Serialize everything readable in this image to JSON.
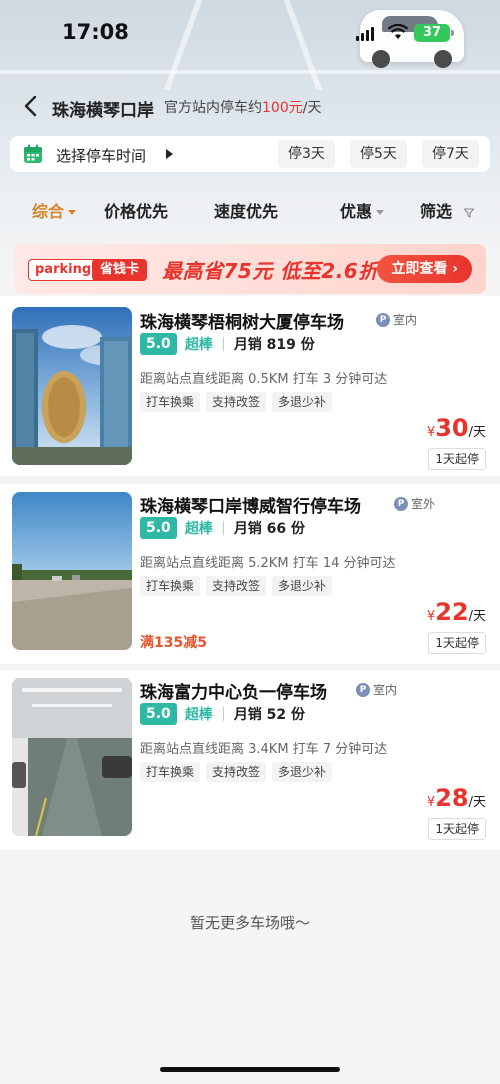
{
  "status_bar": {
    "time": "17:08",
    "battery": "37"
  },
  "header": {
    "title": "珠海横琴口岸",
    "subtitle_prefix": "官方站内停车约",
    "subtitle_price": "100元",
    "subtitle_suffix": "/天"
  },
  "time_bar": {
    "label": "选择停车时间",
    "chips": [
      "停3天",
      "停5天",
      "停7天"
    ]
  },
  "sort_tabs": [
    {
      "label": "综合",
      "active": true
    },
    {
      "label": "价格优先",
      "active": false
    },
    {
      "label": "速度优先",
      "active": false
    },
    {
      "label": "优惠",
      "active": false
    },
    {
      "label": "筛选",
      "active": false
    }
  ],
  "banner": {
    "badge1": "parking",
    "badge2": "省钱卡",
    "slogan": "最高省75元  低至2.6折",
    "cta": "立即查看"
  },
  "lots": [
    {
      "name": "珠海横琴梧桐树大厦停车场",
      "type": "室内",
      "score": "5.0",
      "level": "超棒",
      "sold": "月销 819 份",
      "distance": "距离站点直线距离 0.5KM 打车 3 分钟可达",
      "tags": [
        "打车换乘",
        "支持改签",
        "多退少补"
      ],
      "price": "30",
      "unit": "/天",
      "min_stay": "1天起停",
      "promo": ""
    },
    {
      "name": "珠海横琴口岸博威智行停车场",
      "type": "室外",
      "score": "5.0",
      "level": "超棒",
      "sold": "月销 66 份",
      "distance": "距离站点直线距离 5.2KM 打车 14 分钟可达",
      "tags": [
        "打车换乘",
        "支持改签",
        "多退少补"
      ],
      "price": "22",
      "unit": "/天",
      "min_stay": "1天起停",
      "promo": "满135减5"
    },
    {
      "name": "珠海富力中心负一停车场",
      "type": "室内",
      "score": "5.0",
      "level": "超棒",
      "sold": "月销 52 份",
      "distance": "距离站点直线距离 3.4KM 打车 7 分钟可达",
      "tags": [
        "打车换乘",
        "支持改签",
        "多退少补"
      ],
      "price": "28",
      "unit": "/天",
      "min_stay": "1天起停",
      "promo": ""
    }
  ],
  "currency": "¥",
  "end_text": "暂无更多车场哦～",
  "colors": {
    "accent_red": "#e8342d",
    "accent_orange": "#d9832b",
    "score_teal": "#2fb8a6"
  }
}
